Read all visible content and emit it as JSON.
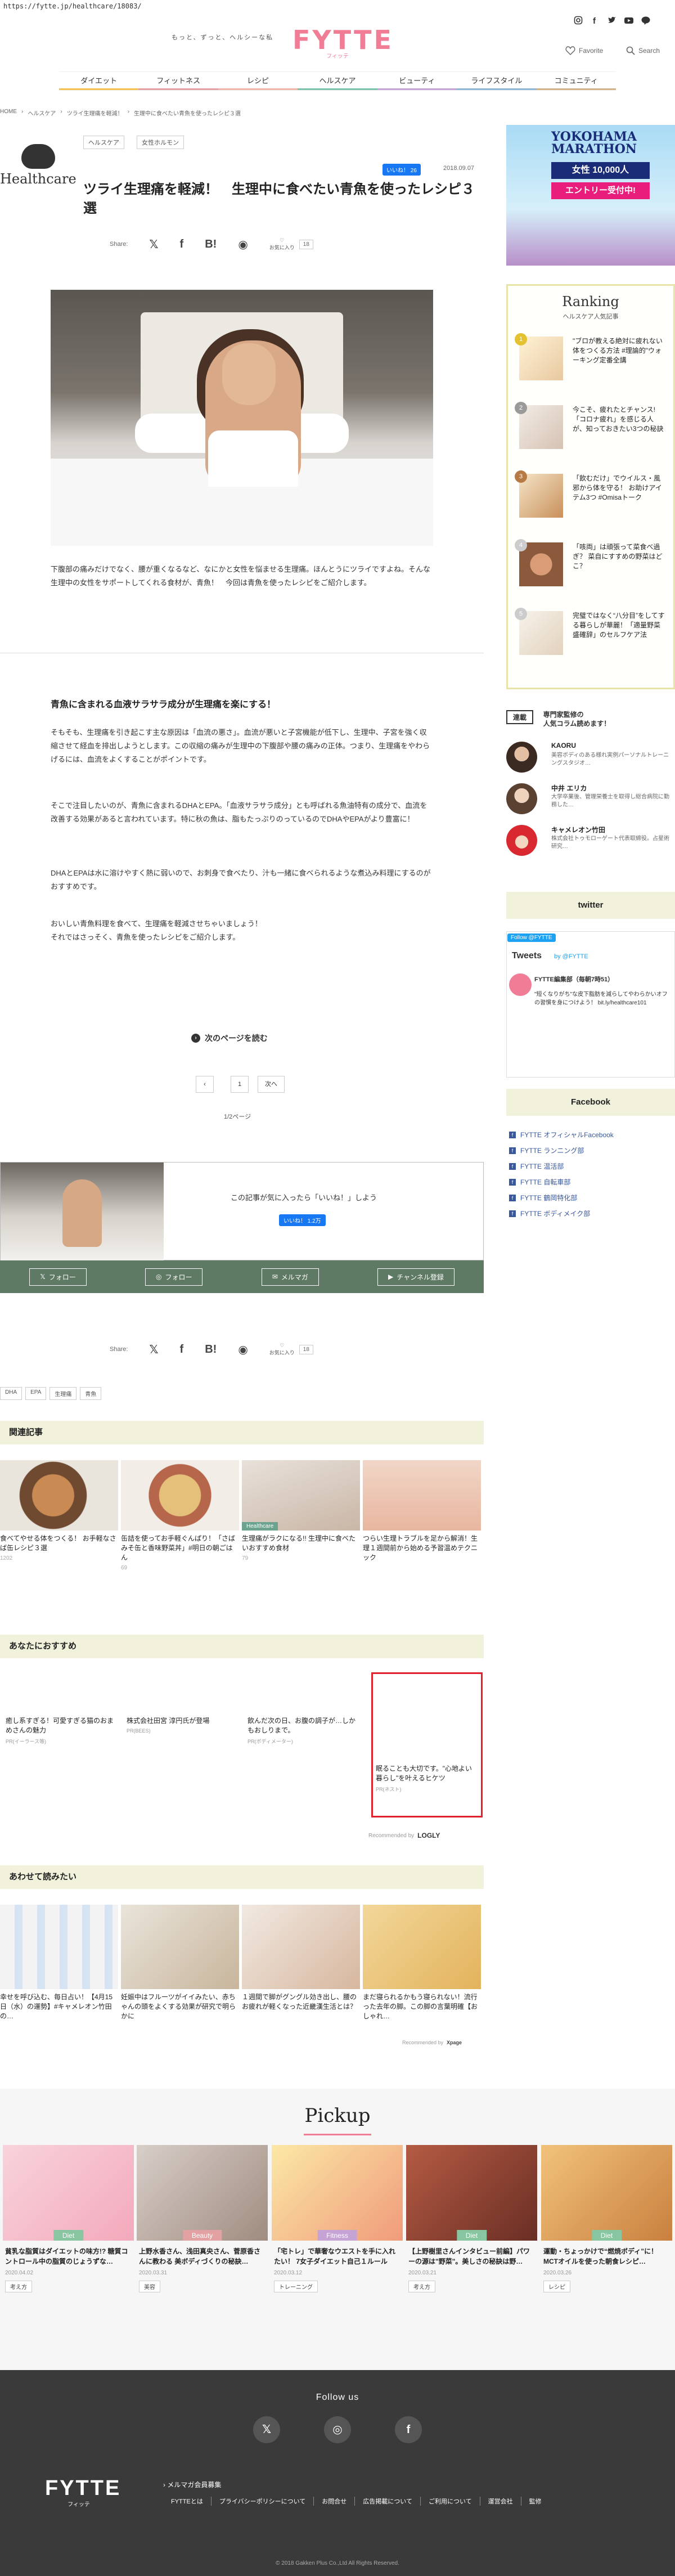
{
  "url": "https://fytte.jp/healthcare/18083/",
  "header": {
    "tagline": "もっと、ずっと、ヘルシーな私",
    "logo": "FYTTE",
    "logo_sub": "フィッテ",
    "favorite": "Favorite",
    "search": "Search",
    "social_icons": [
      "instagram-icon",
      "facebook-icon",
      "twitter-icon",
      "youtube-icon",
      "line-icon"
    ]
  },
  "nav": [
    "ダイエット",
    "フィットネス",
    "レシピ",
    "ヘルスケア",
    "ビューティ",
    "ライフスタイル",
    "コミュニティ"
  ],
  "breadcrumb": [
    "HOME",
    "ヘルスケア",
    "ツライ生理痛を軽減！",
    "生理中に食べたい青魚を使ったレシピ３選"
  ],
  "article": {
    "category": "Healthcare",
    "tags": [
      "ヘルスケア",
      "女性ホルモン"
    ],
    "like_label": "いいね！ 26",
    "date": "2018.09.07",
    "title": "ツライ生理痛を軽減！　生理中に食べたい青魚を使ったレシピ３選",
    "share_label": "Share:",
    "fav_label": "お気に入り",
    "fav_count": "18",
    "intro": "下腹部の痛みだけでなく、腰が重くなるなど、なにかと女性を悩ませる生理痛。ほんとうにツライですよね。そんな生理中の女性をサポートしてくれる食材が、青魚！　今回は青魚を使ったレシピをご紹介します。",
    "h2": "青魚に含まれる血液サラサラ成分が生理痛を楽にする！",
    "p1": "そもそも、生理痛を引き起こす主な原因は「血流の悪さ」。血流が悪いと子宮機能が低下し、生理中、子宮を強く収縮させて経血を排出しようとします。この収縮の痛みが生理中の下腹部や腰の痛みの正体。つまり、生理痛をやわらげるには、血流をよくすることがポイントです。",
    "p2": "そこで注目したいのが、青魚に含まれるDHAとEPA。「血液サラサラ成分」とも呼ばれる魚油特有の成分で、血流を改善する効果があると言われています。特に秋の魚は、脂もたっぷりのっているのでDHAやEPAがより豊富に！",
    "p3": "DHAとEPAは水に溶けやすく熱に弱いので、お刺身で食べたり、汁も一緒に食べられるような煮込み料理にするのがおすすめです。",
    "p4": "おいしい青魚料理を食べて、生理痛を軽減させちゃいましょう！",
    "p5": "それではさっそく、青魚を使ったレシピをご紹介します。",
    "next_page": "次のページを読む",
    "pager_prev": "‹",
    "pager_current": "1",
    "pager_next": "次へ",
    "page_count": "1/2ページ",
    "bottom_tags": [
      "DHA",
      "EPA",
      "生理痛",
      "青魚"
    ]
  },
  "likebox": {
    "text": "この記事が気に入ったら「いいね！」しよう",
    "btn": "いいね！ 1.2万",
    "follow": [
      "フォロー",
      "フォロー",
      "メルマガ",
      "チャンネル登録"
    ]
  },
  "related": {
    "heading": "関連記事",
    "items": [
      {
        "title": "食べてやせる体をつくる！ お手軽なさば缶レシピ３選",
        "meta": "1202"
      },
      {
        "title": "缶詰を使ってお手軽ぐんぱり！「さばみそ缶と香味野菜丼」#明日の朝ごはん",
        "meta": "69"
      },
      {
        "title": "生理痛がラクになる!! 生理中に食べたいおすすめ食材",
        "meta": "79",
        "label": "Healthcare"
      },
      {
        "title": "つらい生理トラブルを足から解消！生理１週間前から始める予習温めテクニック",
        "meta": ""
      }
    ]
  },
  "recommend": {
    "heading": "あなたにおすすめ",
    "items": [
      {
        "title": "癒し系すぎる！可愛すぎる猫のおまめさんの魅力",
        "src": "PR(イーラース等)"
      },
      {
        "title": "株式会社田宮 淳円氏が登場",
        "src": "PR(BEES)"
      },
      {
        "title": "飲んだ次の日、お腹の調子が…しかもおしりまで。",
        "src": "PR(ボディメーター)"
      },
      {
        "title": "眠ることも大切です。\"心地よい暮らし\"を叶えるヒケツ",
        "src": "PR(ネスト)"
      }
    ],
    "credit": "Recommended by",
    "credit_brand": "LOGLY"
  },
  "also": {
    "heading": "あわせて読みたい",
    "items": [
      {
        "title": "幸せを呼び込む、毎日占い！【4月15日（水）の運勢】#キャメレオン竹田の…"
      },
      {
        "title": "妊娠中はフルーツがイイみたい、赤ちゃんの頭をよくする効果が研究で明らかに"
      },
      {
        "title": "１週間で脚がグングル効き出し、腰のお疲れが軽くなった近畿漢生活とは？"
      },
      {
        "title": "まだ寝られるかもう寝られない！流行った去年の脚。この脚の言葉明確【おしゃれ…"
      }
    ],
    "credit": "Recommended by",
    "credit_brand": "Xpage"
  },
  "pickup": {
    "heading": "Pickup",
    "items": [
      {
        "badge": "Diet",
        "color": "#88c5a1",
        "title": "貧乳な脂質はダイエットの味方!? 糖質コントロール中の脂質のじょうずな…",
        "date": "2020.04.02",
        "cat": "考え方"
      },
      {
        "badge": "Beauty",
        "color": "#e2a1a3",
        "title": "上野水香さん、浅田真央さん、菅原香さんに教わる 美ボディづくりの秘訣…",
        "date": "2020.03.31",
        "cat": "美容"
      },
      {
        "badge": "Fitness",
        "color": "#c6a3d5",
        "title": "「宅トレ」で華奢なウエストを手に入れたい！ 7女子ダイエット自己１ルール",
        "date": "2020.03.12",
        "cat": "トレーニング"
      },
      {
        "badge": "Diet",
        "color": "#88c5a1",
        "title": "【上野樹里さんインタビュー前編】パワーの源は\"野菜\"。美しさの秘訣は野…",
        "date": "2020.03.21",
        "cat": "考え方"
      },
      {
        "badge": "Diet",
        "color": "#88c5a1",
        "title": "運動・ちょっかけで“燃焼ボディ”に！ MCTオイルを使った朝食レシピ…",
        "date": "2020.03.26",
        "cat": "レシピ"
      }
    ]
  },
  "sidebar": {
    "ad": {
      "l1": "YOKOHAMA\nMARATHON",
      "l2": "女性 10,000人",
      "l3": "エントリー受付中!"
    },
    "ranking_title": "Ranking",
    "ranking_sub": "ヘルスケア人気記事",
    "ranking": [
      {
        "n": "1",
        "title": "\"ブロが教える絶対に疲れない体をつくる方法 #理論的\"ウォーキング定番全講"
      },
      {
        "n": "2",
        "title": "今こそ、疲れたとチャンス!「コロナ疲れ」を感じる人が、知っておきたい3つの秘訣"
      },
      {
        "n": "3",
        "title": "「飲むだけ」でウイルス・風邪から体を守る！ お助けアイテム3つ #Omisaトーク"
      },
      {
        "n": "4",
        "title": "「咳両」は頑張って菜食べ過ぎ？ 菜自にすすめの野菜はどこ？"
      },
      {
        "n": "5",
        "title": "完璧ではなく“八分目”をしてする暮らしが華麗！「適量野菜盛確辞」のセルフケア法"
      }
    ],
    "expert_tab": "連載",
    "expert_title": "専門家監修の\n人気コラム読めます！",
    "experts": [
      {
        "name": "KAORU",
        "desc": "美容ボディのある様れ実例パーソナルトレーニングスタジオ…"
      },
      {
        "name": "中井 エリカ",
        "desc": "大学卒業後、管理栄養士を取得し総合病院に勤務した…"
      },
      {
        "name": "キャメレオン竹田",
        "desc": "株式会社トゥモローゲート代表取締役。占星術研究…"
      }
    ],
    "twitter_heading": "twitter",
    "tw_follow": "Follow @FYTTE",
    "tw_tweets": "Tweets",
    "tw_by": "by @FYTTE",
    "tw_name": "FYTTE編集部（毎朝7時51）",
    "tw_text": "\"短くなりがち\"な皮下脂肪を減らしてやわらかいオフの習慣を身につけよう！ bit.ly/healthcare101",
    "facebook_heading": "Facebook",
    "fb_links": [
      "FYTTE オフィシャルFacebook",
      "FYTTE ランニング部",
      "FYTTE 温活部",
      "FYTTE 自転車部",
      "FYTTE 鶴岡特化部",
      "FYTTE ボディメイク部"
    ]
  },
  "footer": {
    "follow_us": "Follow us",
    "logo": "FYTTE",
    "logo_sub": "フィッテ",
    "mail": "› メルマガ会員募集",
    "links": [
      "FYTTEとは",
      "プライバシーポリシーについて",
      "お問合せ",
      "広告掲載について",
      "ご利用について",
      "運営会社",
      "監修"
    ],
    "copyright": "© 2018 Gakken Plus Co.,Ltd All Rights Reserved."
  }
}
